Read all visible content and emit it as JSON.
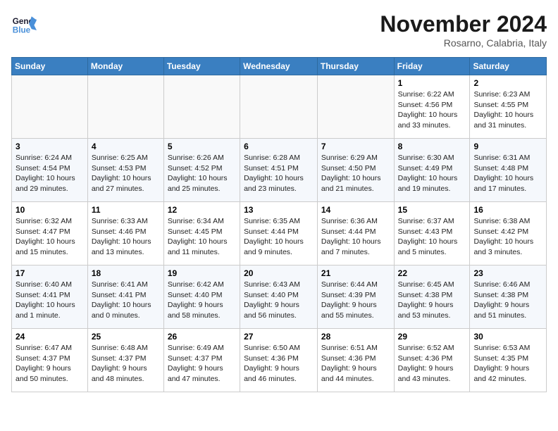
{
  "logo": {
    "line1": "General",
    "line2": "Blue"
  },
  "title": "November 2024",
  "subtitle": "Rosarno, Calabria, Italy",
  "days_of_week": [
    "Sunday",
    "Monday",
    "Tuesday",
    "Wednesday",
    "Thursday",
    "Friday",
    "Saturday"
  ],
  "weeks": [
    [
      {
        "day": "",
        "info": ""
      },
      {
        "day": "",
        "info": ""
      },
      {
        "day": "",
        "info": ""
      },
      {
        "day": "",
        "info": ""
      },
      {
        "day": "",
        "info": ""
      },
      {
        "day": "1",
        "info": "Sunrise: 6:22 AM\nSunset: 4:56 PM\nDaylight: 10 hours\nand 33 minutes."
      },
      {
        "day": "2",
        "info": "Sunrise: 6:23 AM\nSunset: 4:55 PM\nDaylight: 10 hours\nand 31 minutes."
      }
    ],
    [
      {
        "day": "3",
        "info": "Sunrise: 6:24 AM\nSunset: 4:54 PM\nDaylight: 10 hours\nand 29 minutes."
      },
      {
        "day": "4",
        "info": "Sunrise: 6:25 AM\nSunset: 4:53 PM\nDaylight: 10 hours\nand 27 minutes."
      },
      {
        "day": "5",
        "info": "Sunrise: 6:26 AM\nSunset: 4:52 PM\nDaylight: 10 hours\nand 25 minutes."
      },
      {
        "day": "6",
        "info": "Sunrise: 6:28 AM\nSunset: 4:51 PM\nDaylight: 10 hours\nand 23 minutes."
      },
      {
        "day": "7",
        "info": "Sunrise: 6:29 AM\nSunset: 4:50 PM\nDaylight: 10 hours\nand 21 minutes."
      },
      {
        "day": "8",
        "info": "Sunrise: 6:30 AM\nSunset: 4:49 PM\nDaylight: 10 hours\nand 19 minutes."
      },
      {
        "day": "9",
        "info": "Sunrise: 6:31 AM\nSunset: 4:48 PM\nDaylight: 10 hours\nand 17 minutes."
      }
    ],
    [
      {
        "day": "10",
        "info": "Sunrise: 6:32 AM\nSunset: 4:47 PM\nDaylight: 10 hours\nand 15 minutes."
      },
      {
        "day": "11",
        "info": "Sunrise: 6:33 AM\nSunset: 4:46 PM\nDaylight: 10 hours\nand 13 minutes."
      },
      {
        "day": "12",
        "info": "Sunrise: 6:34 AM\nSunset: 4:45 PM\nDaylight: 10 hours\nand 11 minutes."
      },
      {
        "day": "13",
        "info": "Sunrise: 6:35 AM\nSunset: 4:44 PM\nDaylight: 10 hours\nand 9 minutes."
      },
      {
        "day": "14",
        "info": "Sunrise: 6:36 AM\nSunset: 4:44 PM\nDaylight: 10 hours\nand 7 minutes."
      },
      {
        "day": "15",
        "info": "Sunrise: 6:37 AM\nSunset: 4:43 PM\nDaylight: 10 hours\nand 5 minutes."
      },
      {
        "day": "16",
        "info": "Sunrise: 6:38 AM\nSunset: 4:42 PM\nDaylight: 10 hours\nand 3 minutes."
      }
    ],
    [
      {
        "day": "17",
        "info": "Sunrise: 6:40 AM\nSunset: 4:41 PM\nDaylight: 10 hours\nand 1 minute."
      },
      {
        "day": "18",
        "info": "Sunrise: 6:41 AM\nSunset: 4:41 PM\nDaylight: 10 hours\nand 0 minutes."
      },
      {
        "day": "19",
        "info": "Sunrise: 6:42 AM\nSunset: 4:40 PM\nDaylight: 9 hours\nand 58 minutes."
      },
      {
        "day": "20",
        "info": "Sunrise: 6:43 AM\nSunset: 4:40 PM\nDaylight: 9 hours\nand 56 minutes."
      },
      {
        "day": "21",
        "info": "Sunrise: 6:44 AM\nSunset: 4:39 PM\nDaylight: 9 hours\nand 55 minutes."
      },
      {
        "day": "22",
        "info": "Sunrise: 6:45 AM\nSunset: 4:38 PM\nDaylight: 9 hours\nand 53 minutes."
      },
      {
        "day": "23",
        "info": "Sunrise: 6:46 AM\nSunset: 4:38 PM\nDaylight: 9 hours\nand 51 minutes."
      }
    ],
    [
      {
        "day": "24",
        "info": "Sunrise: 6:47 AM\nSunset: 4:37 PM\nDaylight: 9 hours\nand 50 minutes."
      },
      {
        "day": "25",
        "info": "Sunrise: 6:48 AM\nSunset: 4:37 PM\nDaylight: 9 hours\nand 48 minutes."
      },
      {
        "day": "26",
        "info": "Sunrise: 6:49 AM\nSunset: 4:37 PM\nDaylight: 9 hours\nand 47 minutes."
      },
      {
        "day": "27",
        "info": "Sunrise: 6:50 AM\nSunset: 4:36 PM\nDaylight: 9 hours\nand 46 minutes."
      },
      {
        "day": "28",
        "info": "Sunrise: 6:51 AM\nSunset: 4:36 PM\nDaylight: 9 hours\nand 44 minutes."
      },
      {
        "day": "29",
        "info": "Sunrise: 6:52 AM\nSunset: 4:36 PM\nDaylight: 9 hours\nand 43 minutes."
      },
      {
        "day": "30",
        "info": "Sunrise: 6:53 AM\nSunset: 4:35 PM\nDaylight: 9 hours\nand 42 minutes."
      }
    ]
  ]
}
